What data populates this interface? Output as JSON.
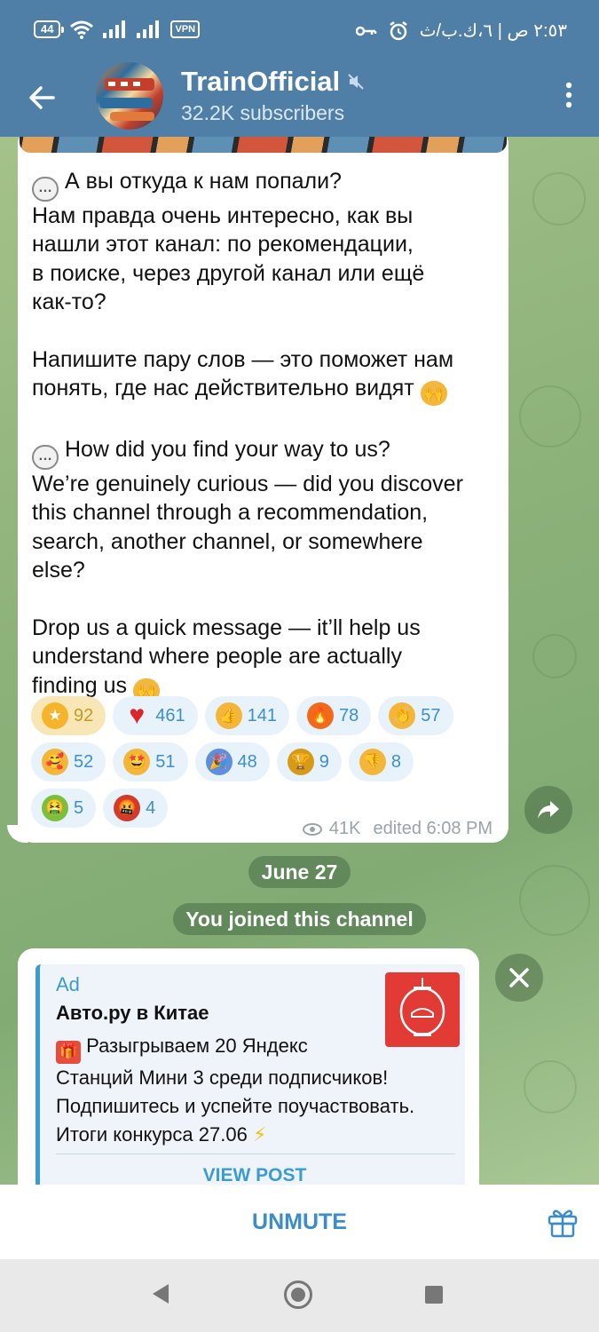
{
  "status_bar": {
    "battery": "44",
    "vpn": "VPN",
    "time_locale": "٢:٥٣ ص | ٦،ك.ب/ث"
  },
  "header": {
    "channel_name": "TrainOfficial",
    "subscribers": "32.2K subscribers",
    "muted_icon": "speaker-muted-icon"
  },
  "message": {
    "lines": [
      "А вы откуда к нам попали?",
      "Нам правда очень интересно, как вы",
      "нашли этот канал: по рекомендации,",
      "в поиске, через другой канал или ещё",
      "как-то?",
      "",
      "Напишите пару слов — это поможет нам",
      "понять, где нас действительно видят",
      "",
      "How did you find your way to us?",
      "We’re genuinely curious — did you discover",
      "this channel through a recommendation,",
      "search, another channel, or somewhere",
      "else?",
      "",
      "Drop us a quick message — it’ll help us",
      "understand where people are actually",
      "finding us"
    ],
    "views": "41K",
    "edited": "edited 6:08 PM"
  },
  "reactions": [
    {
      "emoji": "⭐",
      "count": "92",
      "active": true,
      "color": "#f5b42a"
    },
    {
      "emoji": "♥",
      "count": "461",
      "active": false,
      "color": "#e0242c"
    },
    {
      "emoji": "👍",
      "count": "141",
      "active": false,
      "color": "#f3b63a"
    },
    {
      "emoji": "🔥",
      "count": "78",
      "active": false,
      "color": "#f06a1c"
    },
    {
      "emoji": "👏",
      "count": "57",
      "active": false,
      "color": "#f3b63a"
    },
    {
      "emoji": "🥰",
      "count": "52",
      "active": false,
      "color": "#f3b63a"
    },
    {
      "emoji": "🤩",
      "count": "51",
      "active": false,
      "color": "#f3b63a"
    },
    {
      "emoji": "🎉",
      "count": "48",
      "active": false,
      "color": "#5d8fe0"
    },
    {
      "emoji": "🏆",
      "count": "9",
      "active": false,
      "color": "#d79a16"
    },
    {
      "emoji": "👎",
      "count": "8",
      "active": false,
      "color": "#f3b63a"
    },
    {
      "emoji": "🤮",
      "count": "5",
      "active": false,
      "color": "#7bbf3a"
    },
    {
      "emoji": "🤬",
      "count": "4",
      "active": false,
      "color": "#d23a2a"
    }
  ],
  "date_pill": "June 27",
  "service_pill": "You joined this channel",
  "ad": {
    "label": "Ad",
    "name": "Авто.ру в Китае",
    "text": "Разыгрываем 20 Яндекс\nСтанций Мини 3 среди подписчиков!\nПодпишитесь и успейте поучаствовать.\nИтоги конкурса 27.06",
    "button": "VIEW POST"
  },
  "bottom": {
    "unmute": "UNMUTE"
  },
  "colors": {
    "header": "#4f7fa6",
    "accent": "#3a8dc8"
  }
}
